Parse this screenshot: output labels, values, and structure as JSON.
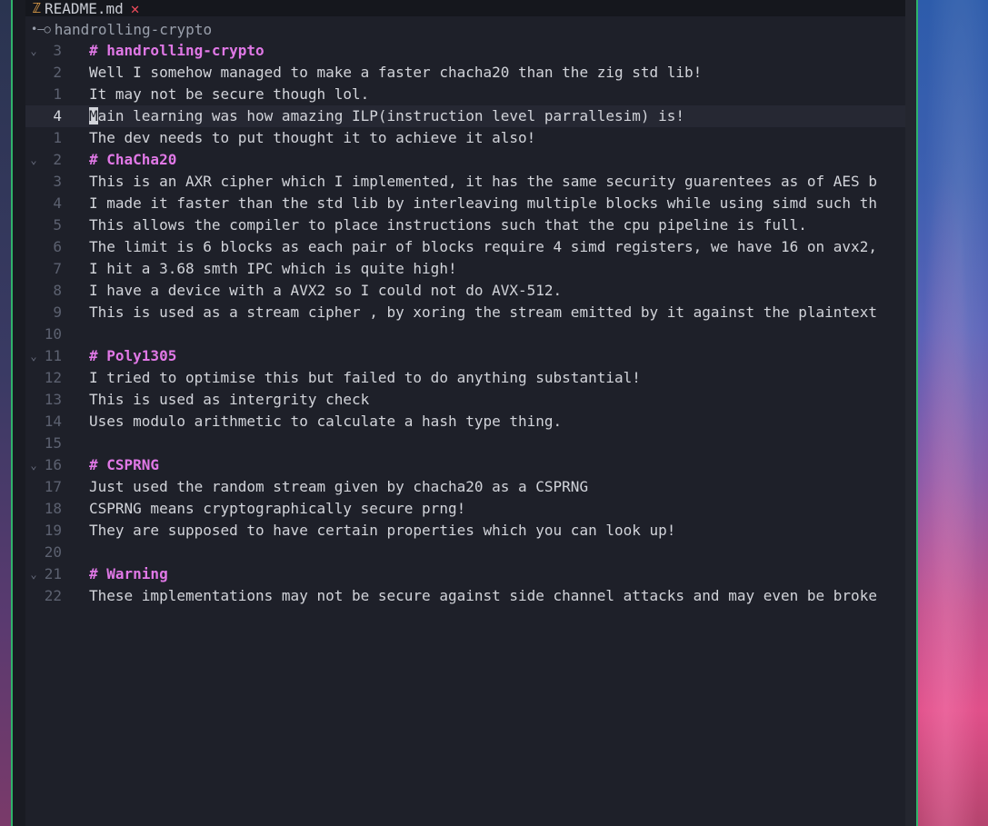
{
  "tab": {
    "icon": "zig-file-icon",
    "title": "README.md",
    "close": "✕"
  },
  "breadcrumb": {
    "icon": "git-branch-icon",
    "text": "handrolling-crypto"
  },
  "cursor_line": 3,
  "lines": [
    {
      "num": "3",
      "fold": true,
      "heading": true,
      "text": "# handrolling-crypto"
    },
    {
      "num": "2",
      "fold": false,
      "heading": false,
      "text": "Well I somehow managed to make a faster chacha20 than the zig std lib!"
    },
    {
      "num": "1",
      "fold": false,
      "heading": false,
      "text": "It may not be secure though lol."
    },
    {
      "num": "4",
      "fold": false,
      "heading": false,
      "text": "Main learning was how amazing ILP(instruction level parrallesim) is!"
    },
    {
      "num": "1",
      "fold": false,
      "heading": false,
      "text": "The dev needs to put thought it to achieve it also!"
    },
    {
      "num": "2",
      "fold": true,
      "heading": true,
      "text": "# ChaCha20"
    },
    {
      "num": "3",
      "fold": false,
      "heading": false,
      "text": "This is an AXR cipher which I implemented, it has the same security guarentees as of AES b"
    },
    {
      "num": "4",
      "fold": false,
      "heading": false,
      "text": "I made it faster than the std lib by interleaving multiple blocks while using simd such th"
    },
    {
      "num": "5",
      "fold": false,
      "heading": false,
      "text": "This allows the compiler to place instructions such that the cpu pipeline is full."
    },
    {
      "num": "6",
      "fold": false,
      "heading": false,
      "text": "The limit is 6 blocks as each pair of blocks require 4 simd registers, we have 16 on avx2,"
    },
    {
      "num": "7",
      "fold": false,
      "heading": false,
      "text": "I hit a 3.68 smth IPC which is quite high!"
    },
    {
      "num": "8",
      "fold": false,
      "heading": false,
      "text": "I have a device with a AVX2 so I could not do AVX-512."
    },
    {
      "num": "9",
      "fold": false,
      "heading": false,
      "text": "This is used as a stream cipher , by xoring the stream emitted by it against the plaintext"
    },
    {
      "num": "10",
      "fold": false,
      "heading": false,
      "text": ""
    },
    {
      "num": "11",
      "fold": true,
      "heading": true,
      "text": "# Poly1305"
    },
    {
      "num": "12",
      "fold": false,
      "heading": false,
      "text": "I tried to optimise this but failed to do anything substantial!"
    },
    {
      "num": "13",
      "fold": false,
      "heading": false,
      "text": "This is used as intergrity check"
    },
    {
      "num": "14",
      "fold": false,
      "heading": false,
      "text": "Uses modulo arithmetic to calculate a hash type thing."
    },
    {
      "num": "15",
      "fold": false,
      "heading": false,
      "text": ""
    },
    {
      "num": "16",
      "fold": true,
      "heading": true,
      "text": "# CSPRNG"
    },
    {
      "num": "17",
      "fold": false,
      "heading": false,
      "text": "Just used the random stream given by chacha20 as a CSPRNG"
    },
    {
      "num": "18",
      "fold": false,
      "heading": false,
      "text": "CSPRNG means cryptographically secure prng!"
    },
    {
      "num": "19",
      "fold": false,
      "heading": false,
      "text": "They are supposed to have certain properties which you can look up!"
    },
    {
      "num": "20",
      "fold": false,
      "heading": false,
      "text": ""
    },
    {
      "num": "21",
      "fold": true,
      "heading": true,
      "text": "# Warning"
    },
    {
      "num": "22",
      "fold": false,
      "heading": false,
      "text": "These implementations may not be secure against side channel attacks and may even be broke"
    }
  ]
}
